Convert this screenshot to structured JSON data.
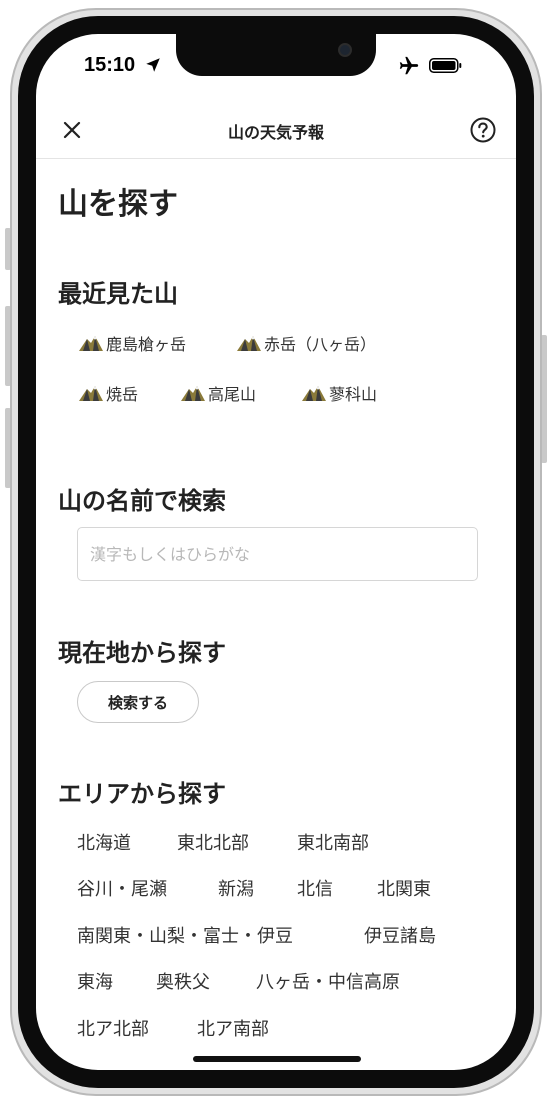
{
  "status": {
    "time": "15:10"
  },
  "nav": {
    "title": "山の天気予報"
  },
  "page_title": "山を探す",
  "recent": {
    "title": "最近見た山",
    "items": [
      "鹿島槍ヶ岳",
      "赤岳（八ヶ岳）",
      "焼岳",
      "高尾山",
      "蓼科山"
    ]
  },
  "search": {
    "title": "山の名前で検索",
    "placeholder": "漢字もしくはひらがな",
    "value": ""
  },
  "location": {
    "title": "現在地から探す",
    "button_label": "検索する"
  },
  "areas": {
    "title": "エリアから探す",
    "items": [
      "北海道",
      "東北北部",
      "東北南部",
      "谷川・尾瀬",
      "新潟",
      "北信",
      "北関東",
      "南関東・山梨・富士・伊豆",
      "伊豆諸島",
      "東海",
      "奥秩父",
      "八ヶ岳・中信高原",
      "北ア北部",
      "北ア南部"
    ]
  },
  "colors": {
    "mountain_rock": "#8a7a3a",
    "mountain_dark": "#3b3b3b",
    "snow": "#f2f2f2",
    "border": "#d6d6d6"
  }
}
